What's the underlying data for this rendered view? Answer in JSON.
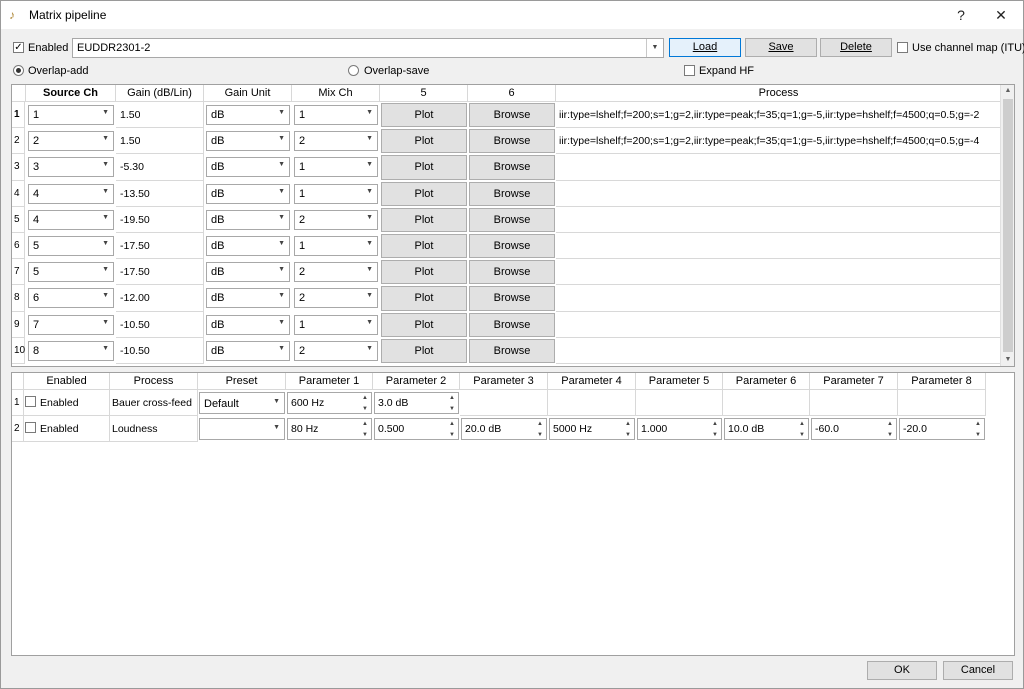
{
  "window": {
    "title": "Matrix pipeline",
    "help_glyph": "?",
    "close_glyph": "✕",
    "icon": "speaker-icon"
  },
  "top": {
    "enabled_label": "Enabled",
    "enabled_checked": true,
    "preset_name": "EUDDR2301-2",
    "load_label": "Load",
    "save_label": "Save",
    "delete_label": "Delete",
    "channel_map_label": "Use channel map (ITU)",
    "overlap_add_label": "Overlap-add",
    "overlap_save_label": "Overlap-save",
    "expand_hf_label": "Expand HF"
  },
  "matrix": {
    "headers": [
      "Source Ch",
      "Gain (dB/Lin)",
      "Gain Unit",
      "Mix Ch",
      "5",
      "6",
      "Process"
    ],
    "rows": [
      {
        "n": "1",
        "src": "1",
        "gain": "1.50",
        "unit": "dB",
        "mix": "1",
        "plot": "Plot",
        "browse": "Browse",
        "process": "iir:type=lshelf;f=200;s=1;g=2,iir:type=peak;f=35;q=1;g=-5,iir:type=hshelf;f=4500;q=0.5;g=-2"
      },
      {
        "n": "2",
        "src": "2",
        "gain": "1.50",
        "unit": "dB",
        "mix": "2",
        "plot": "Plot",
        "browse": "Browse",
        "process": "iir:type=lshelf;f=200;s=1;g=2,iir:type=peak;f=35;q=1;g=-5,iir:type=hshelf;f=4500;q=0.5;g=-4"
      },
      {
        "n": "3",
        "src": "3",
        "gain": "-5.30",
        "unit": "dB",
        "mix": "1",
        "plot": "Plot",
        "browse": "Browse",
        "process": ""
      },
      {
        "n": "4",
        "src": "4",
        "gain": "-13.50",
        "unit": "dB",
        "mix": "1",
        "plot": "Plot",
        "browse": "Browse",
        "process": ""
      },
      {
        "n": "5",
        "src": "4",
        "gain": "-19.50",
        "unit": "dB",
        "mix": "2",
        "plot": "Plot",
        "browse": "Browse",
        "process": ""
      },
      {
        "n": "6",
        "src": "5",
        "gain": "-17.50",
        "unit": "dB",
        "mix": "1",
        "plot": "Plot",
        "browse": "Browse",
        "process": ""
      },
      {
        "n": "7",
        "src": "5",
        "gain": "-17.50",
        "unit": "dB",
        "mix": "2",
        "plot": "Plot",
        "browse": "Browse",
        "process": ""
      },
      {
        "n": "8",
        "src": "6",
        "gain": "-12.00",
        "unit": "dB",
        "mix": "2",
        "plot": "Plot",
        "browse": "Browse",
        "process": ""
      },
      {
        "n": "9",
        "src": "7",
        "gain": "-10.50",
        "unit": "dB",
        "mix": "1",
        "plot": "Plot",
        "browse": "Browse",
        "process": ""
      },
      {
        "n": "10",
        "src": "8",
        "gain": "-10.50",
        "unit": "dB",
        "mix": "2",
        "plot": "Plot",
        "browse": "Browse",
        "process": ""
      }
    ]
  },
  "effects": {
    "headers": [
      "Enabled",
      "Process",
      "Preset",
      "Parameter 1",
      "Parameter 2",
      "Parameter 3",
      "Parameter 4",
      "Parameter 5",
      "Parameter 6",
      "Parameter 7",
      "Parameter 8"
    ],
    "rows": [
      {
        "n": "1",
        "enabled_label": "Enabled",
        "process": "Bauer cross-feed",
        "preset": "Default",
        "params": [
          "600 Hz",
          "3.0 dB"
        ]
      },
      {
        "n": "2",
        "enabled_label": "Enabled",
        "process": "Loudness",
        "preset": "",
        "params": [
          "80 Hz",
          "0.500",
          "20.0 dB",
          "5000 Hz",
          "1.000",
          "10.0 dB",
          "-60.0",
          "-20.0"
        ]
      }
    ]
  },
  "footer": {
    "ok_label": "OK",
    "cancel_label": "Cancel"
  }
}
